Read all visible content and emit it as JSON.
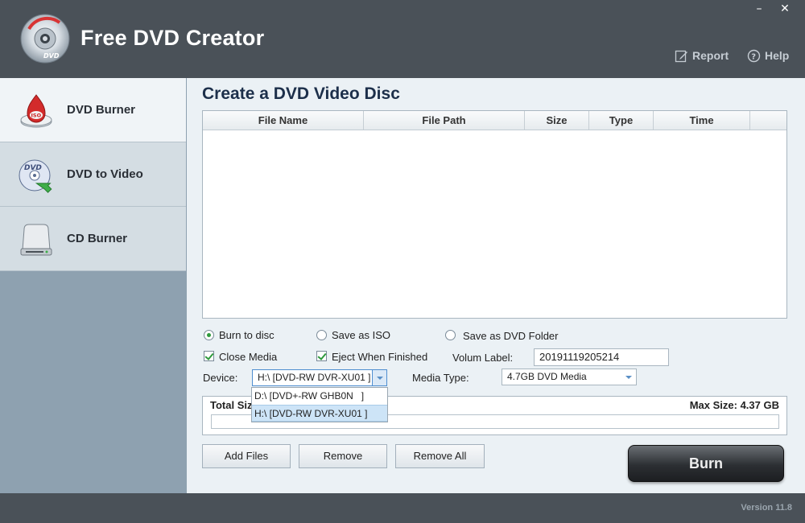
{
  "window": {
    "title": "Free DVD Creator",
    "minimize": "–",
    "close": "✕"
  },
  "header": {
    "report_label": "Report",
    "help_label": "Help"
  },
  "sidebar": {
    "items": [
      {
        "label": "DVD Burner",
        "icon": "dvd-burner-iso-icon",
        "active": true
      },
      {
        "label": "DVD to Video",
        "icon": "dvd-to-video-icon",
        "active": false
      },
      {
        "label": "CD Burner",
        "icon": "cd-burner-drive-icon",
        "active": false
      }
    ]
  },
  "main": {
    "title": "Create a DVD Video Disc",
    "table": {
      "columns": [
        "File Name",
        "File Path",
        "Size",
        "Type",
        "Time"
      ],
      "rows": []
    },
    "options": {
      "burn_to_disc": "Burn to disc",
      "save_as_iso": "Save as ISO",
      "save_as_folder": "Save as DVD Folder",
      "selected_output": "burn_to_disc",
      "close_media": "Close Media",
      "close_media_checked": true,
      "eject_when_finished": "Eject When Finished",
      "eject_checked": true,
      "volume_label_caption": "Volum Label:",
      "volume_label_value": "20191119205214",
      "device_caption": "Device:",
      "device_value": "H:\\ [DVD-RW DVR-XU01 ]",
      "device_options": [
        "D:\\ [DVD+-RW GHB0N   ]",
        "H:\\ [DVD-RW DVR-XU01 ]"
      ],
      "device_selected_index": 1,
      "media_type_caption": "Media Type:",
      "media_type_value": "4.7GB DVD Media"
    },
    "size": {
      "total_label": "Total Siz",
      "max_label": "Max Size: 4.37 GB",
      "used_fraction": 0
    },
    "buttons": {
      "add_files": "Add Files",
      "remove": "Remove",
      "remove_all": "Remove All",
      "burn": "Burn"
    }
  },
  "footer": {
    "version": "Version 11.8"
  },
  "colors": {
    "chrome": "#4a5158",
    "sidebar": "#8ea1b0",
    "main_bg": "#ebf1f5",
    "accent_green": "#2e9a3c",
    "title_blue": "#1c2f4a"
  }
}
